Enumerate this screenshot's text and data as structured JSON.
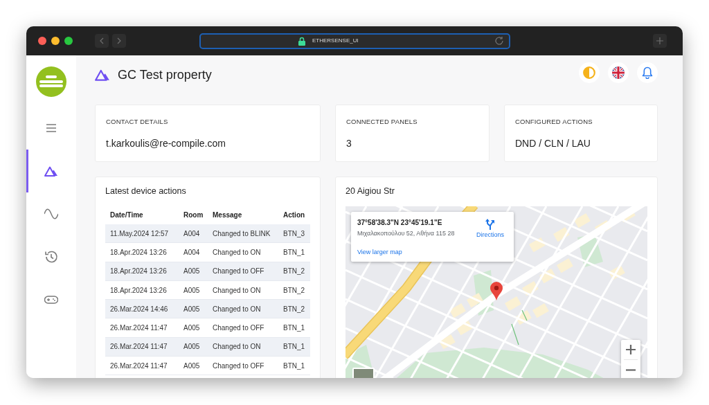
{
  "browser": {
    "address": "ETHERSENSE_UI"
  },
  "sidebar": {
    "items": [
      {
        "kind": "menu",
        "selected": false
      },
      {
        "kind": "property",
        "selected": true
      },
      {
        "kind": "wave",
        "selected": false
      },
      {
        "kind": "history",
        "selected": false
      },
      {
        "kind": "gamepad",
        "selected": false
      }
    ]
  },
  "header": {
    "title": "GC Test property"
  },
  "summary_cards": [
    {
      "label": "CONTACT DETAILS",
      "value": "t.karkoulis@re-compile.com"
    },
    {
      "label": "CONNECTED PANELS",
      "value": "3"
    },
    {
      "label": "CONFIGURED ACTIONS",
      "value": "DND / CLN / LAU"
    }
  ],
  "device_actions": {
    "title": "Latest device actions",
    "columns": [
      "Date/Time",
      "Room",
      "Message",
      "Action"
    ],
    "rows": [
      [
        "11.May.2024 12:57",
        "A004",
        "Changed to BLINK",
        "BTN_3"
      ],
      [
        "18.Apr.2024 13:26",
        "A004",
        "Changed to ON",
        "BTN_1"
      ],
      [
        "18.Apr.2024 13:26",
        "A005",
        "Changed to OFF",
        "BTN_2"
      ],
      [
        "18.Apr.2024 13:26",
        "A005",
        "Changed to ON",
        "BTN_2"
      ],
      [
        "26.Mar.2024 14:46",
        "A005",
        "Changed to ON",
        "BTN_2"
      ],
      [
        "26.Mar.2024 11:47",
        "A005",
        "Changed to OFF",
        "BTN_1"
      ],
      [
        "26.Mar.2024 11:47",
        "A005",
        "Changed to ON",
        "BTN_1"
      ],
      [
        "26.Mar.2024 11:47",
        "A005",
        "Changed to OFF",
        "BTN_1"
      ]
    ]
  },
  "location": {
    "title": "20 Aigiou Str",
    "map_info": {
      "coordinates": "37°58'38.3\"N 23°45'19.1\"E",
      "address": "Μιχαλακοπούλου 52, Αθήνα 115 28",
      "directions": "Directions",
      "larger_map_link": "View larger map"
    }
  }
}
